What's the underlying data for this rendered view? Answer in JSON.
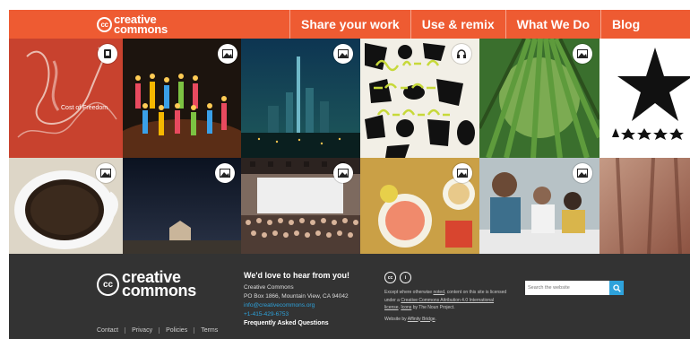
{
  "header": {
    "logo_cc": "cc",
    "logo_line1": "creative",
    "logo_line2": "commons",
    "brand_color": "#ee5b32",
    "nav": [
      {
        "label": "Share your work"
      },
      {
        "label": "Use & remix"
      },
      {
        "label": "What We Do"
      },
      {
        "label": "Blog"
      }
    ]
  },
  "gallery": {
    "tiles": [
      {
        "title": "Cost of Freedom",
        "badge": "audio-file-icon"
      },
      {
        "title": "",
        "badge": "image-icon"
      },
      {
        "title": "",
        "badge": "image-icon"
      },
      {
        "title": "",
        "badge": "headphones-icon"
      },
      {
        "title": "",
        "badge": "image-icon"
      },
      {
        "title": "",
        "badge": "none"
      },
      {
        "title": "",
        "badge": "image-icon"
      },
      {
        "title": "",
        "badge": "image-icon"
      },
      {
        "title": "",
        "badge": "image-icon"
      },
      {
        "title": "",
        "badge": "image-icon"
      },
      {
        "title": "",
        "badge": "image-icon"
      },
      {
        "title": "",
        "badge": "none"
      }
    ]
  },
  "footer": {
    "logo_cc": "cc",
    "logo_line1": "creative",
    "logo_line2": "commons",
    "links": [
      "Contact",
      "Privacy",
      "Policies",
      "Terms"
    ],
    "contact": {
      "title": "We'd love to hear from you!",
      "org": "Creative Commons",
      "address": "PO Box 1866, Mountain View, CA 94042",
      "email": "info@creativecommons.org",
      "phone": "+1-415-429-6753",
      "faq": "Frequently Asked Questions"
    },
    "license": {
      "icon_cc": "cc",
      "icon_by": "i",
      "text_a": "Except where otherwise ",
      "text_noted": "noted",
      "text_b": ", content on this site is licensed under a ",
      "text_license": "Creative Commons Attribution 4.0 International license",
      "text_c": ". ",
      "text_icons": "Icons",
      "text_d": " by The Noun Project.",
      "website_by_label": "Website by ",
      "website_by_name": "Affinity Bridge",
      "website_by_end": "."
    },
    "search": {
      "placeholder": "Search the website",
      "accent": "#2ea2db"
    }
  }
}
